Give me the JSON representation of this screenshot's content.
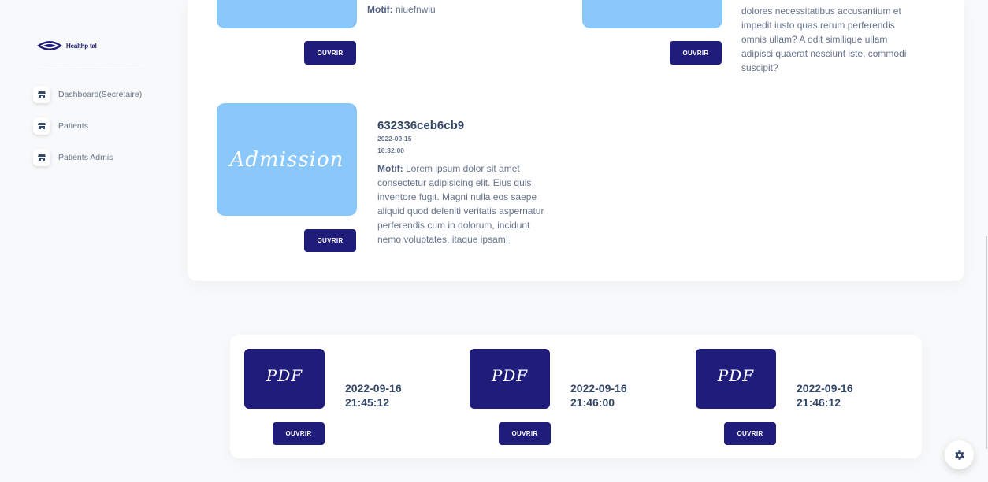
{
  "brand": {
    "name": "Healthp tal"
  },
  "sidebar": {
    "items": [
      {
        "label": "Dashboard(Secretaire)"
      },
      {
        "label": "Patients"
      },
      {
        "label": "Patients Admis"
      }
    ]
  },
  "admissions": {
    "top_left": {
      "motif_label": "Motif:",
      "motif": "niuefnwiu",
      "button": "OUVRIR"
    },
    "top_right": {
      "lines": [
        "dolores necessitatibus accusantium et",
        "impedit iusto quas rerum perferendis",
        "omnis ullam? A odit similique ullam",
        "adipisci quaerat nesciunt iste, commodi",
        "suscipit?"
      ],
      "button": "OUVRIR"
    },
    "featured": {
      "thumb_label": "Admission",
      "id": "632336ceb6cb9",
      "date": "2022-09-15",
      "time": "16:32:00",
      "motif_label": "Motif:",
      "motif_lines": [
        " Lorem ipsum dolor sit amet",
        "consectetur adipisicing elit. Eius quis",
        "inventore fugit. Magni nulla eos saepe",
        "aliquid quod deleniti veritatis aspernatur",
        "perferendis cum in dolorum, incidunt",
        "nemo voluptates, itaque ipsam!"
      ],
      "button": "OUVRIR"
    }
  },
  "documents": [
    {
      "thumb_label": "PDF",
      "date": "2022-09-16",
      "time": "21:45:12",
      "button": "OUVRIR"
    },
    {
      "thumb_label": "PDF",
      "date": "2022-09-16",
      "time": "21:46:00",
      "button": "OUVRIR"
    },
    {
      "thumb_label": "PDF",
      "date": "2022-09-16",
      "time": "21:46:12",
      "button": "OUVRIR"
    }
  ],
  "colors": {
    "accent": "#1f1c7a",
    "thumb": "#8ac8fb",
    "text": "#344767",
    "muted": "#67748e"
  },
  "icons": {
    "nav": "shop-icon",
    "settings": "gear-icon",
    "logo": "eye-logo-icon"
  }
}
